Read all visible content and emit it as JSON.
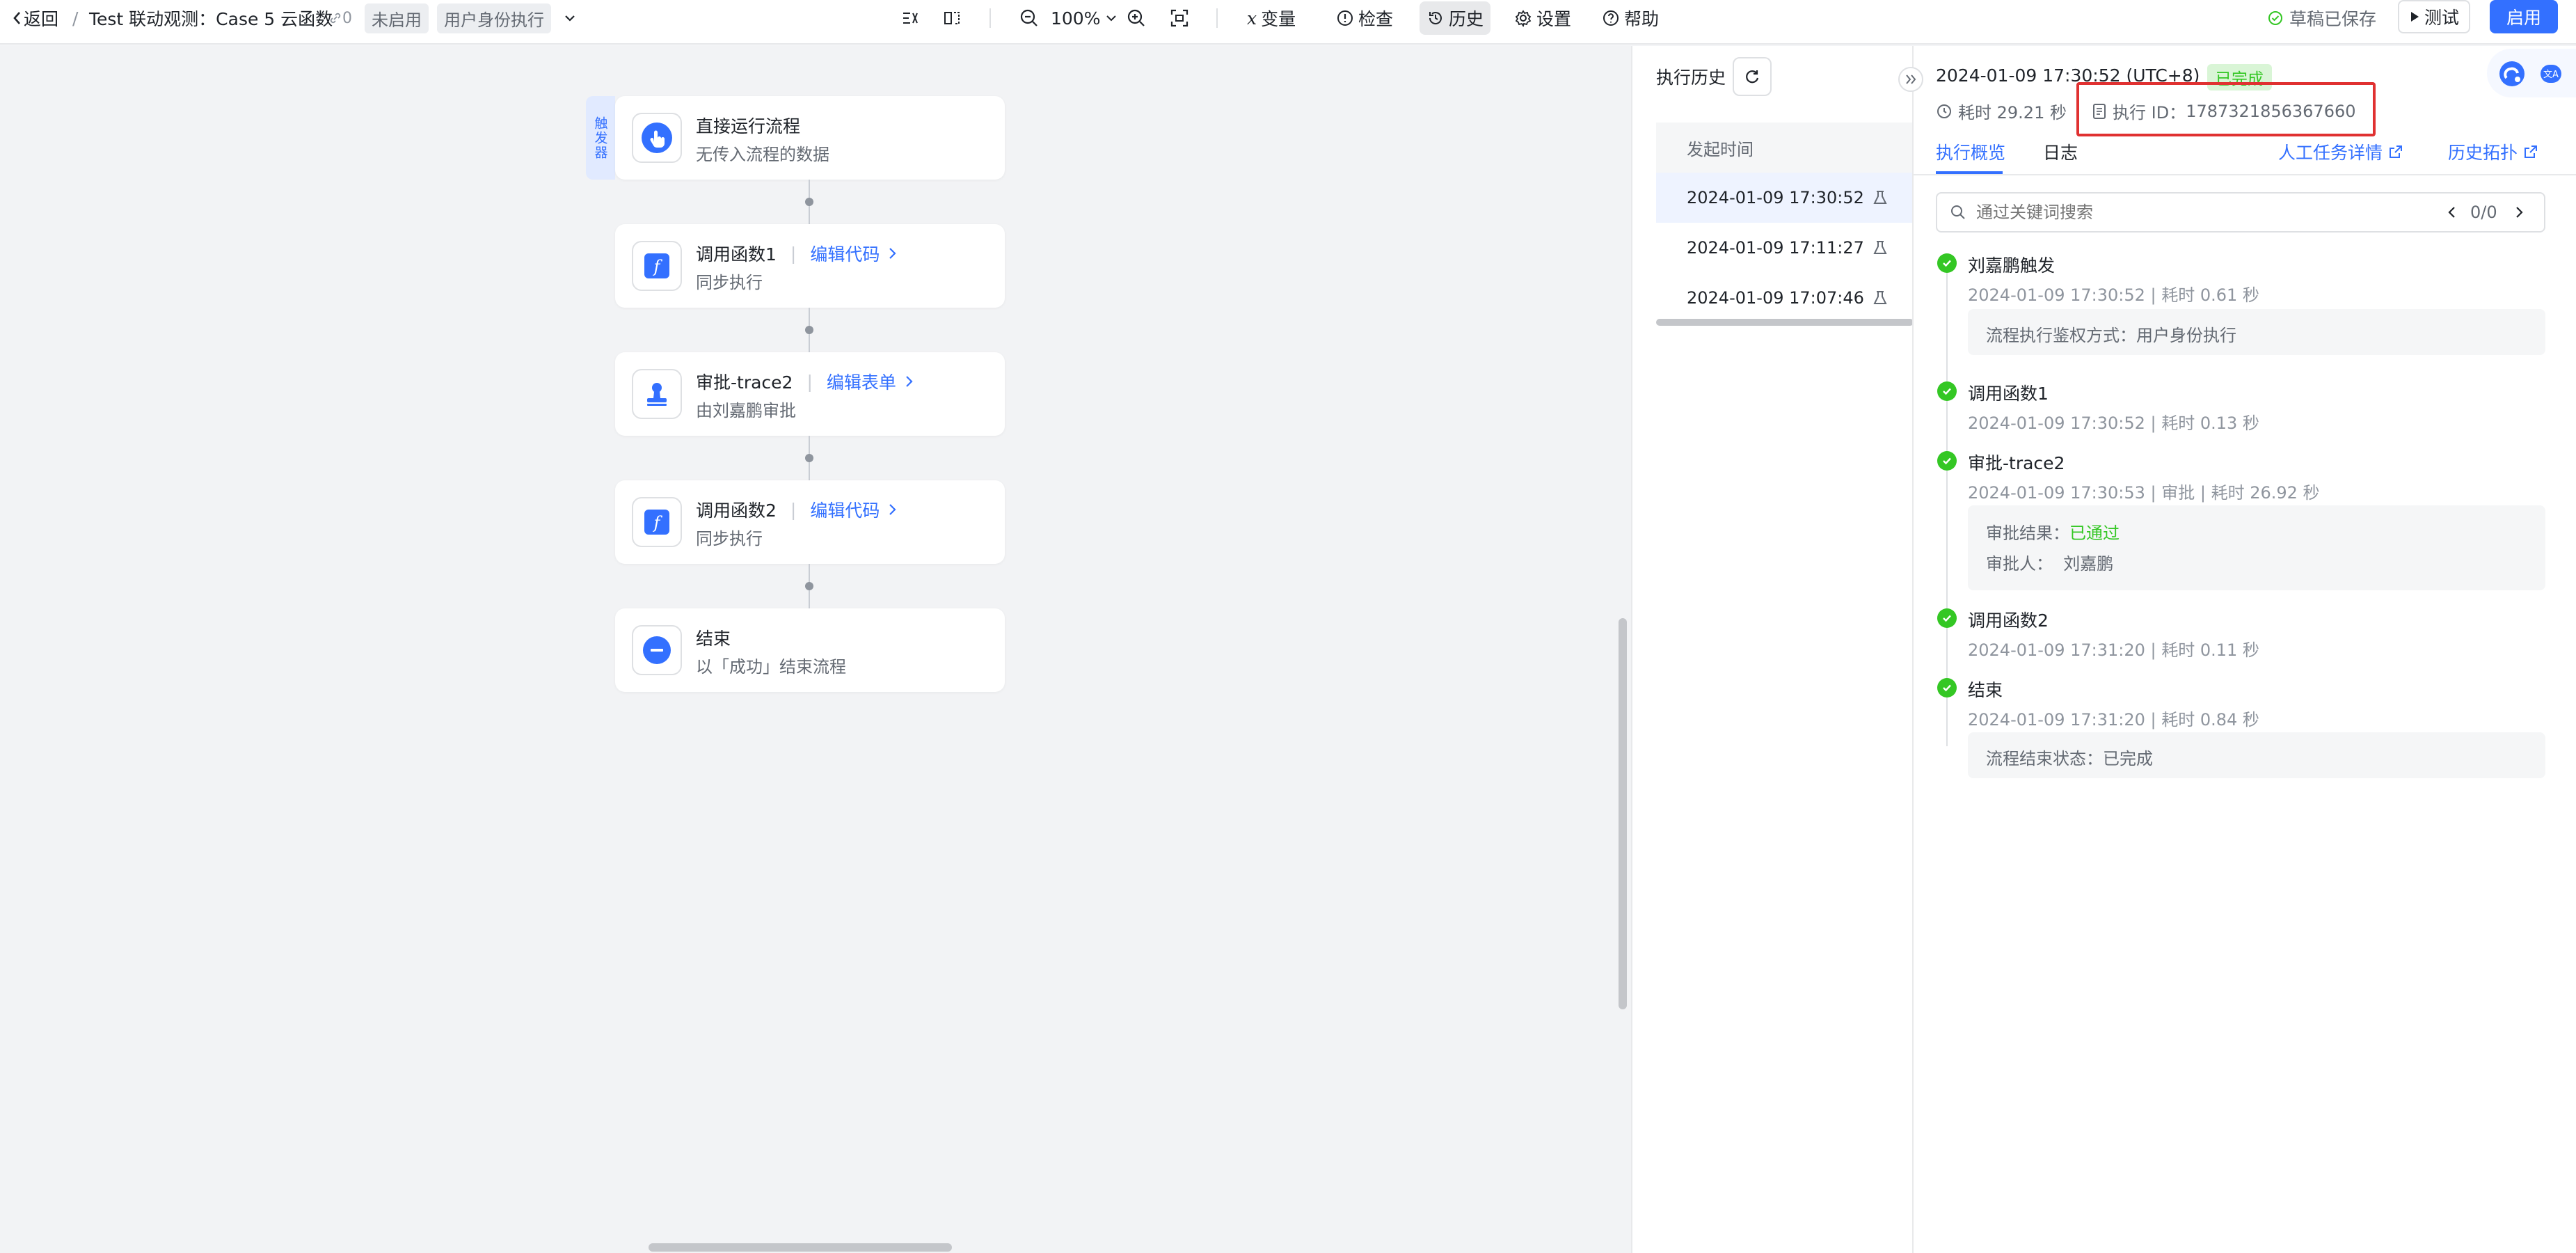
{
  "colors": {
    "accent": "#3370ff",
    "success": "#34c724",
    "highlight_border": "#e03131"
  },
  "header": {
    "back_label": "返回",
    "breadcrumb_sep": "/",
    "title": "Test 联动观测：Case 5 云函数",
    "link_count": "0",
    "status_tag": "未启用",
    "auth_tag": "用户身份执行",
    "zoom": "100%",
    "variables_label": "变量",
    "check_label": "检查",
    "history_label": "历史",
    "settings_label": "设置",
    "help_label": "帮助",
    "saved_label": "草稿已保存",
    "test_label": "测试",
    "enable_label": "启用"
  },
  "flow": {
    "trigger_tab": "触发器",
    "nodes": [
      {
        "title": "直接运行流程",
        "sub": "无传入流程的数据",
        "icon": "hand-pointer-icon"
      },
      {
        "title": "调用函数1",
        "action": "编辑代码",
        "sub": "同步执行",
        "icon": "function-icon"
      },
      {
        "title": "审批-trace2",
        "action": "编辑表单",
        "sub": "由刘嘉鹏审批",
        "icon": "approval-stamp-icon"
      },
      {
        "title": "调用函数2",
        "action": "编辑代码",
        "sub": "同步执行",
        "icon": "function-icon"
      },
      {
        "title": "结束",
        "sub": "以「成功」结束流程",
        "icon": "end-icon"
      }
    ]
  },
  "history": {
    "title": "执行历史",
    "col_header": "发起时间",
    "rows": [
      "2024-01-09 17:30:52",
      "2024-01-09 17:11:27",
      "2024-01-09 17:07:46"
    ]
  },
  "detail": {
    "time": "2024-01-09 17:30:52 (UTC+8)",
    "status": "已完成",
    "duration": "耗时 29.21 秒",
    "exec_id_label": "执行 ID：",
    "exec_id": "1787321856367660",
    "tabs": [
      "执行概览",
      "日志"
    ],
    "manual_task_link": "人工任务详情",
    "history_topology_link": "历史拓扑",
    "search_placeholder": "通过关键词搜索",
    "search_count": "0/0",
    "timeline": [
      {
        "title": "刘嘉鹏触发",
        "meta": "2024-01-09 17:30:52 | 耗时 0.61 秒",
        "box": [
          "流程执行鉴权方式：用户身份执行"
        ]
      },
      {
        "title": "调用函数1",
        "meta": "2024-01-09 17:30:52 | 耗时 0.13 秒"
      },
      {
        "title": "审批-trace2",
        "meta": "2024-01-09 17:30:53 | 审批 | 耗时 26.92 秒",
        "result_label": "审批结果：",
        "result_value": "已通过",
        "approver": "审批人：  刘嘉鹏"
      },
      {
        "title": "调用函数2",
        "meta": "2024-01-09 17:31:20 | 耗时 0.11 秒"
      },
      {
        "title": "结束",
        "meta": "2024-01-09 17:31:20 | 耗时 0.84 秒",
        "box": [
          "流程结束状态：已完成"
        ]
      }
    ]
  }
}
